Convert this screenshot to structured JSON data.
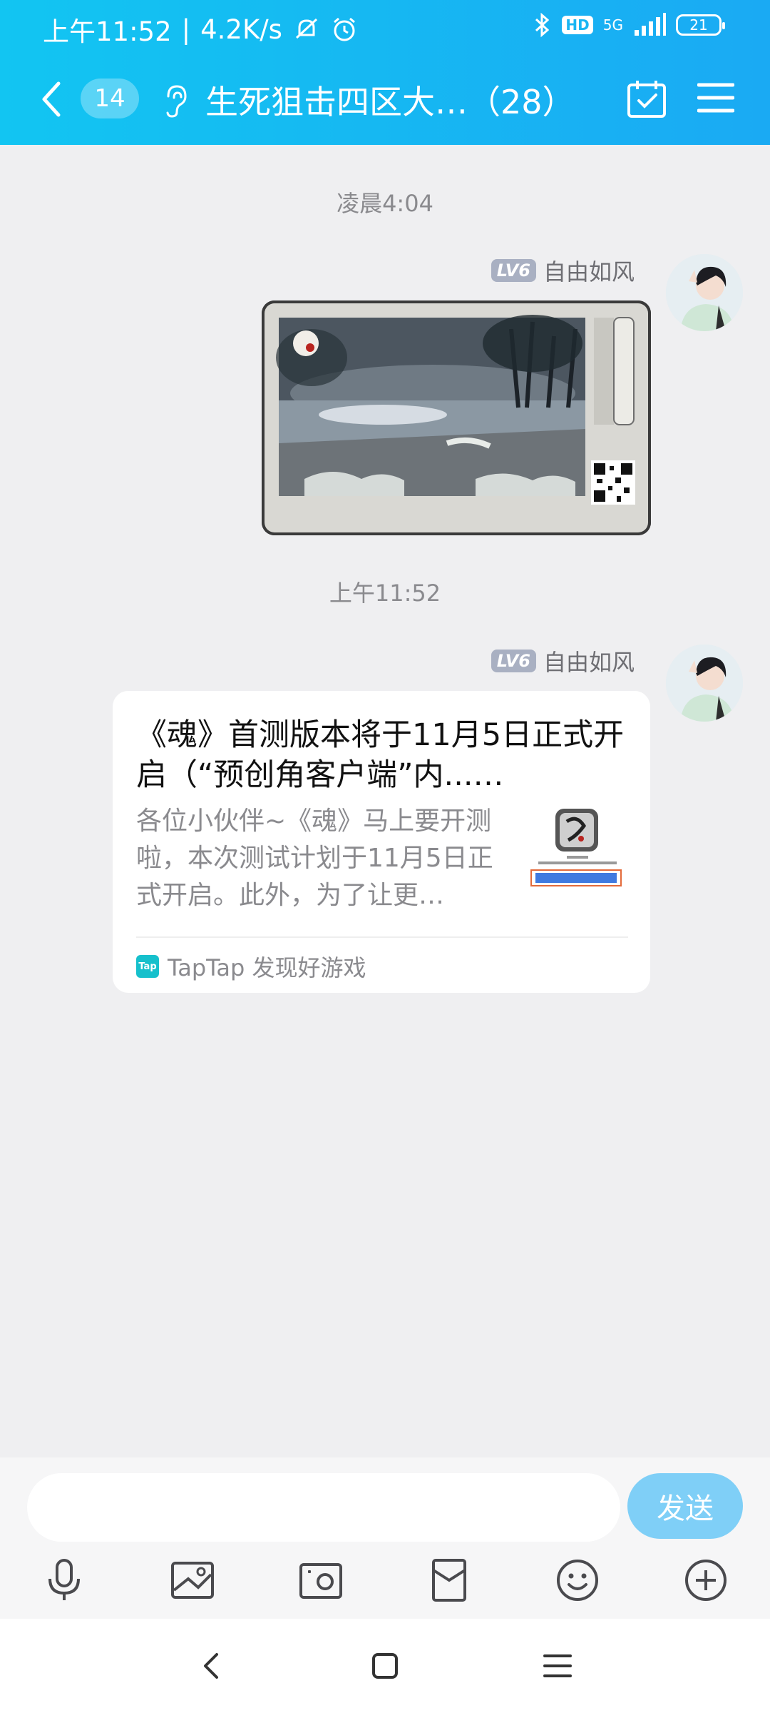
{
  "status": {
    "time": "上午11:52",
    "speed": "4.2K/s",
    "network": "5G",
    "hd": "HD",
    "battery": "21"
  },
  "header": {
    "unread_count": "14",
    "group_title": "生死狙击四区大…（28）"
  },
  "messages": [
    {
      "time": "凌晨4:04",
      "sender": "自由如风",
      "level": "LV6",
      "type": "image"
    },
    {
      "time": "上午11:52",
      "sender": "自由如风",
      "level": "LV6",
      "type": "link",
      "card": {
        "title": "《魂》首测版本将于11月5日正式开启（“预创角客户端”内...…",
        "description": "各位小伙伴~《魂》马上要开测啦，本次测试计划于11月5日正式开启。此外，为了让更…",
        "source": "TapTap 发现好游戏",
        "source_logo": "Tap"
      }
    }
  ],
  "input": {
    "placeholder": "",
    "send_label": "发送"
  },
  "toolbar": [
    "microphone-icon",
    "image-icon",
    "camera-icon",
    "red-packet-icon",
    "emoji-icon",
    "plus-icon"
  ],
  "colors": {
    "header_start": "#12c5f2",
    "header_end": "#1aaaf3",
    "send_button": "#7fcff7",
    "background": "#efeff1"
  }
}
